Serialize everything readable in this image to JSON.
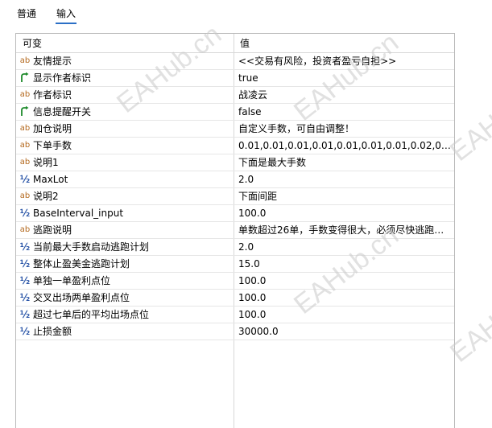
{
  "tabs": [
    {
      "label": "普通"
    },
    {
      "label": "输入"
    }
  ],
  "table": {
    "col_name": "可变",
    "col_value": "值"
  },
  "rows": [
    {
      "icon": "ab",
      "name": "友情提示",
      "value": "<<交易有风险，投资者盈亏自担>>"
    },
    {
      "icon": "bool",
      "name": "显示作者标识",
      "value": "true"
    },
    {
      "icon": "ab",
      "name": "作者标识",
      "value": "战凌云"
    },
    {
      "icon": "bool",
      "name": "信息提醒开关",
      "value": "false"
    },
    {
      "icon": "ab",
      "name": "加仓说明",
      "value": "自定义手数，可自由调整！"
    },
    {
      "icon": "ab",
      "name": "下单手数",
      "value": "0.01,0.01,0.01,0.01,0.01,0.01,0.01,0.02,0.02,0...."
    },
    {
      "icon": "ab",
      "name": "说明1",
      "value": "下面是最大手数"
    },
    {
      "icon": "half",
      "name": "MaxLot",
      "value": "2.0"
    },
    {
      "icon": "ab",
      "name": "说明2",
      "value": "下面间距"
    },
    {
      "icon": "half",
      "name": "BaseInterval_input",
      "value": "100.0"
    },
    {
      "icon": "ab",
      "name": "逃跑说明",
      "value": "单数超过26单，手数变得很大，必须尽快逃跑，..."
    },
    {
      "icon": "half",
      "name": "当前最大手数启动逃跑计划",
      "value": "2.0"
    },
    {
      "icon": "half",
      "name": "整体止盈美金逃跑计划",
      "value": "15.0"
    },
    {
      "icon": "half",
      "name": "单独一单盈利点位",
      "value": "100.0"
    },
    {
      "icon": "half",
      "name": "交叉出场两单盈利点位",
      "value": "100.0"
    },
    {
      "icon": "half",
      "name": "超过七单后的平均出场点位",
      "value": "100.0"
    },
    {
      "icon": "half",
      "name": "止损金额",
      "value": "30000.0"
    }
  ],
  "watermark": "EAHub.cn",
  "colors": {
    "accent": "#2b6fc6",
    "string_icon": "#b46a1f",
    "number_icon": "#2b56a8",
    "bool_icon": "#1f8b2c"
  }
}
